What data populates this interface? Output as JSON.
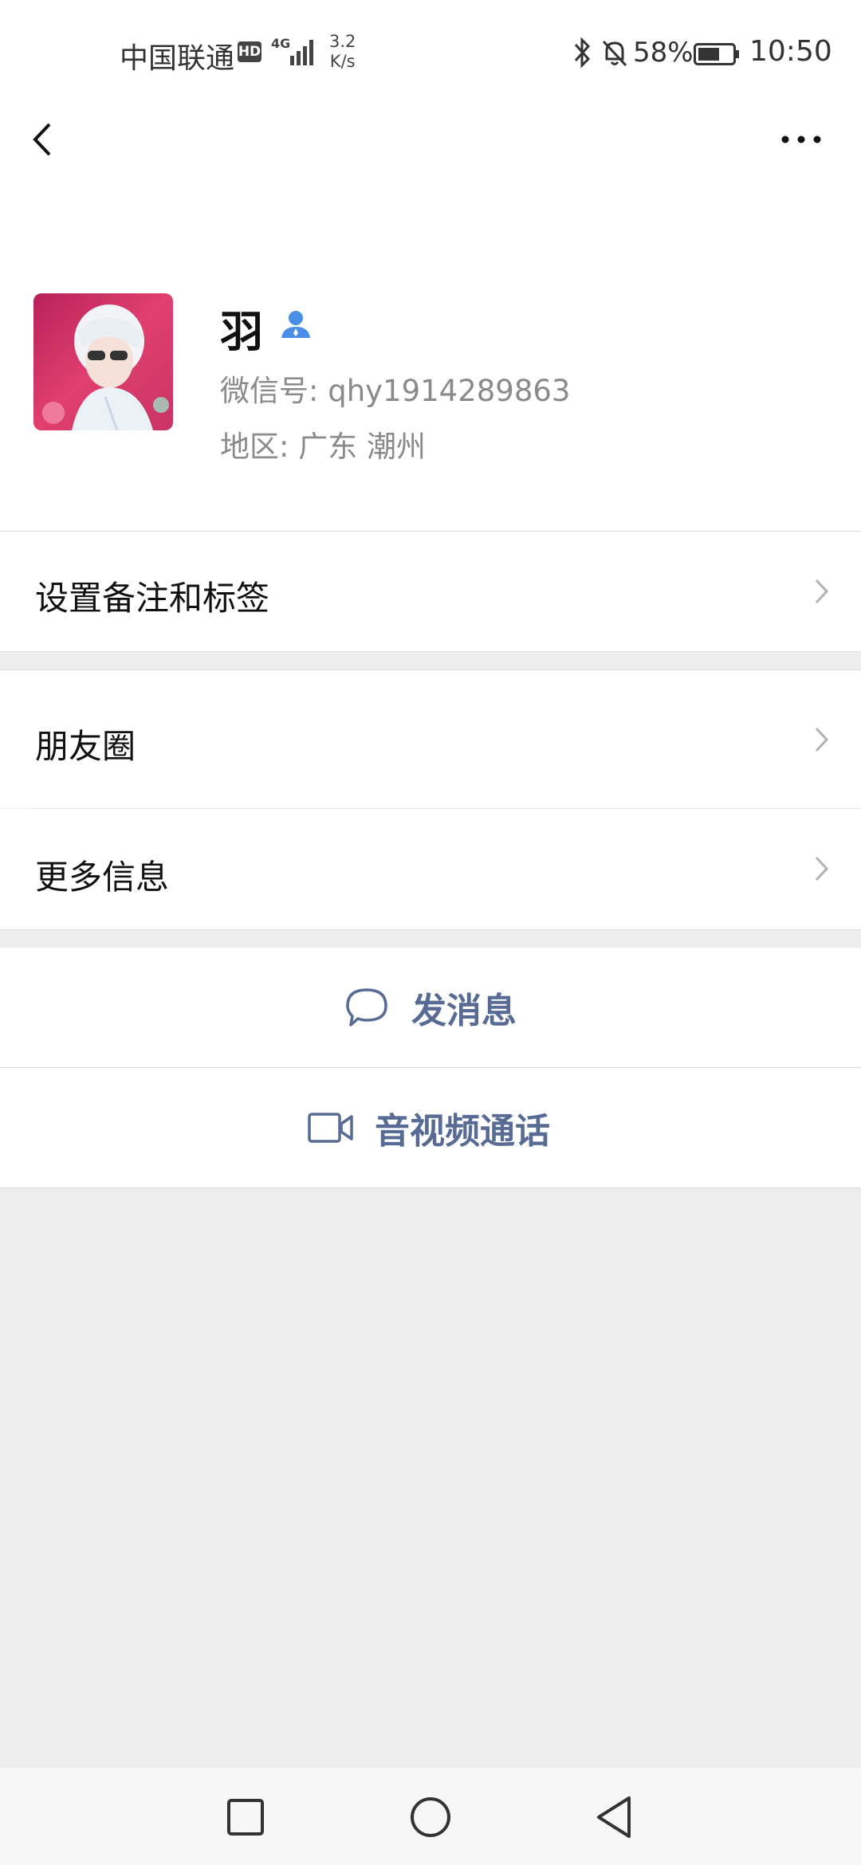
{
  "status_bar": {
    "carrier": "中国联通",
    "hd_badge": "HD",
    "network": "4G",
    "speed_value": "3.2",
    "speed_unit": "K/s",
    "battery_percent": "58%",
    "time": "10:50",
    "icons": [
      "bluetooth-icon",
      "mute-bell-icon",
      "battery-icon",
      "signal-icon"
    ]
  },
  "header": {
    "back_icon": "chevron-left-icon",
    "more_icon": "more-dots-icon"
  },
  "profile": {
    "name": "羽",
    "wechat_id": "微信号: qhy1914289863",
    "region": "地区: 广东  潮州",
    "badge_icon": "person-icon",
    "badge_color": "#4a8fe7"
  },
  "menu": {
    "remark_tags": "设置备注和标签",
    "moments": "朋友圈",
    "more_info": "更多信息"
  },
  "actions": {
    "send_message": "发消息",
    "video_call": "音视频通话",
    "accent_color": "#576b95"
  },
  "system_nav": {
    "icons": [
      "square-recents-icon",
      "circle-home-icon",
      "triangle-back-icon"
    ]
  }
}
